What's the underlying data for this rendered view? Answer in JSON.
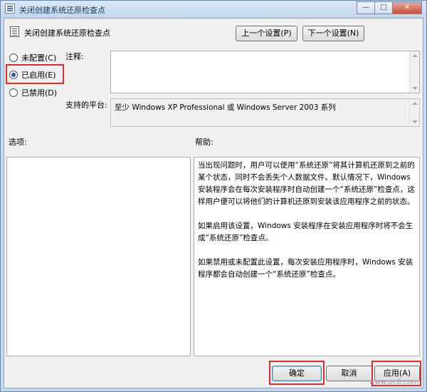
{
  "window": {
    "title": "关闭创建系统还原检查点",
    "controls": {
      "minimize": "—",
      "maximize": "□",
      "close": "✕"
    }
  },
  "policy": {
    "name": "关闭创建系统还原检查点",
    "prev_button": "上一个设置(P)",
    "next_button": "下一个设置(N)"
  },
  "options": {
    "not_configured": "未配置(C)",
    "enabled": "已启用(E)",
    "disabled": "已禁用(D)"
  },
  "comment": {
    "label": "注释:",
    "value": ""
  },
  "platform": {
    "label": "支持的平台:",
    "value": "至少 Windows XP Professional 或 Windows Server 2003 系列"
  },
  "sections": {
    "options_label": "选项:",
    "help_label": "帮助:"
  },
  "help": {
    "paragraphs": [
      "当出现问题时，用户可以使用“系统还原”将其计算机还原到之前的某个状态，同时不会丢失个人数据文件。默认情况下，Windows 安装程序会在每次安装程序时自动创建一个“系统还原”检查点，这样用户便可以将他们的计算机还原到安装该应用程序之前的状态。",
      "如果启用该设置，Windows 安装程序在安装应用程序时将不会生成“系统还原”检查点。",
      "如果禁用或未配置此设置，每次安装应用程序时，Windows 安装程序都会自动创建一个“系统还原”检查点。"
    ]
  },
  "footer": {
    "ok": "确定",
    "cancel": "取消",
    "apply": "应用(A)"
  },
  "watermark": "www.pc6.com",
  "colors": {
    "highlight": "#e02b2b",
    "accent": "#2a59a8"
  }
}
